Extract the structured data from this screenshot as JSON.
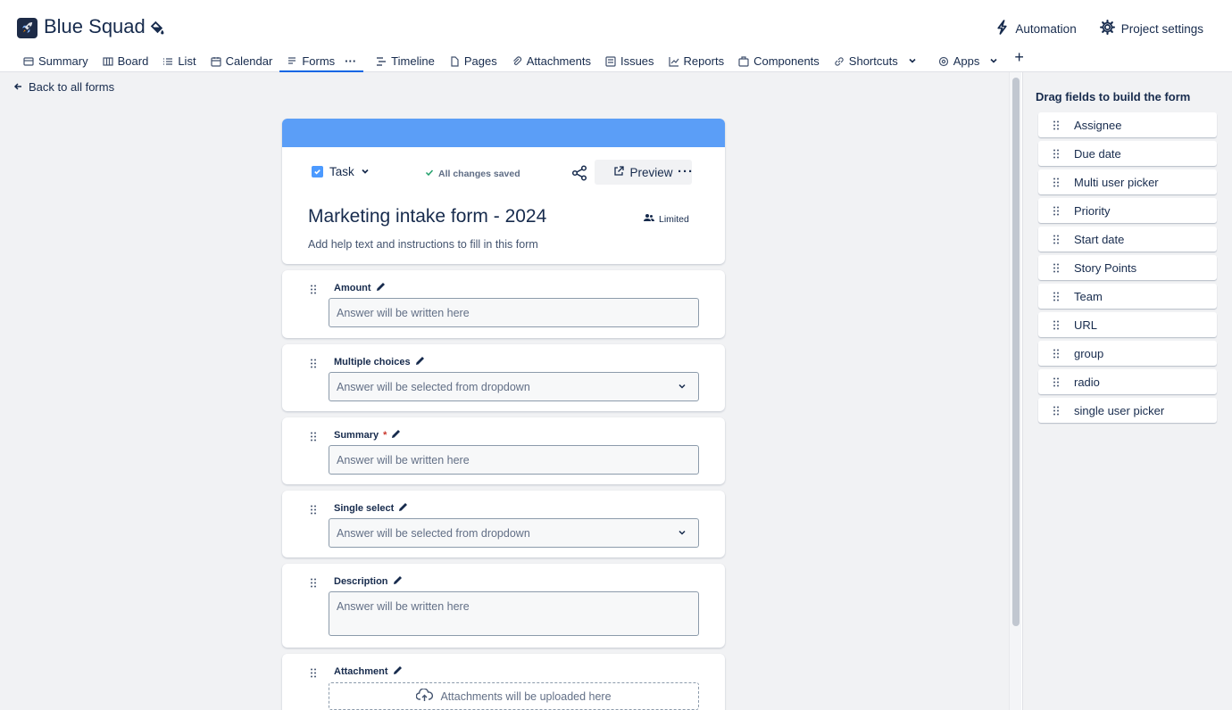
{
  "header": {
    "project_name": "Blue Squad",
    "automation": "Automation",
    "project_settings": "Project settings"
  },
  "tabs": [
    {
      "label": "Summary"
    },
    {
      "label": "Board"
    },
    {
      "label": "List"
    },
    {
      "label": "Calendar"
    },
    {
      "label": "Forms",
      "active": true
    },
    {
      "label": "Timeline"
    },
    {
      "label": "Pages"
    },
    {
      "label": "Attachments"
    },
    {
      "label": "Issues"
    },
    {
      "label": "Reports"
    },
    {
      "label": "Components"
    },
    {
      "label": "Shortcuts"
    },
    {
      "label": "Apps"
    }
  ],
  "back_link": "Back to all forms",
  "form": {
    "issue_type": "Task",
    "save_status": "All changes saved",
    "preview_label": "Preview",
    "title": "Marketing intake form - 2024",
    "access": "Limited",
    "help_text": "Add help text and instructions to fill in this form",
    "banner_color": "#5b9ef7"
  },
  "fields": [
    {
      "label": "Amount",
      "placeholder": "Answer will be written here",
      "kind": "text"
    },
    {
      "label": "Multiple choices",
      "placeholder": "Answer will be selected from dropdown",
      "kind": "dropdown"
    },
    {
      "label": "Summary",
      "required_mark": "*",
      "placeholder": "Answer will be written here",
      "kind": "text"
    },
    {
      "label": "Single select",
      "placeholder": "Answer will be selected from dropdown",
      "kind": "dropdown"
    },
    {
      "label": "Description",
      "placeholder": "Answer will be written here",
      "kind": "textarea"
    },
    {
      "label": "Attachment",
      "placeholder": "Attachments will be uploaded here",
      "kind": "upload"
    }
  ],
  "sidebar": {
    "title": "Drag fields to build the form",
    "items": [
      "Assignee",
      "Due date",
      "Multi user picker",
      "Priority",
      "Start date",
      "Story Points",
      "Team",
      "URL",
      "group",
      "radio",
      "single user picker"
    ]
  }
}
